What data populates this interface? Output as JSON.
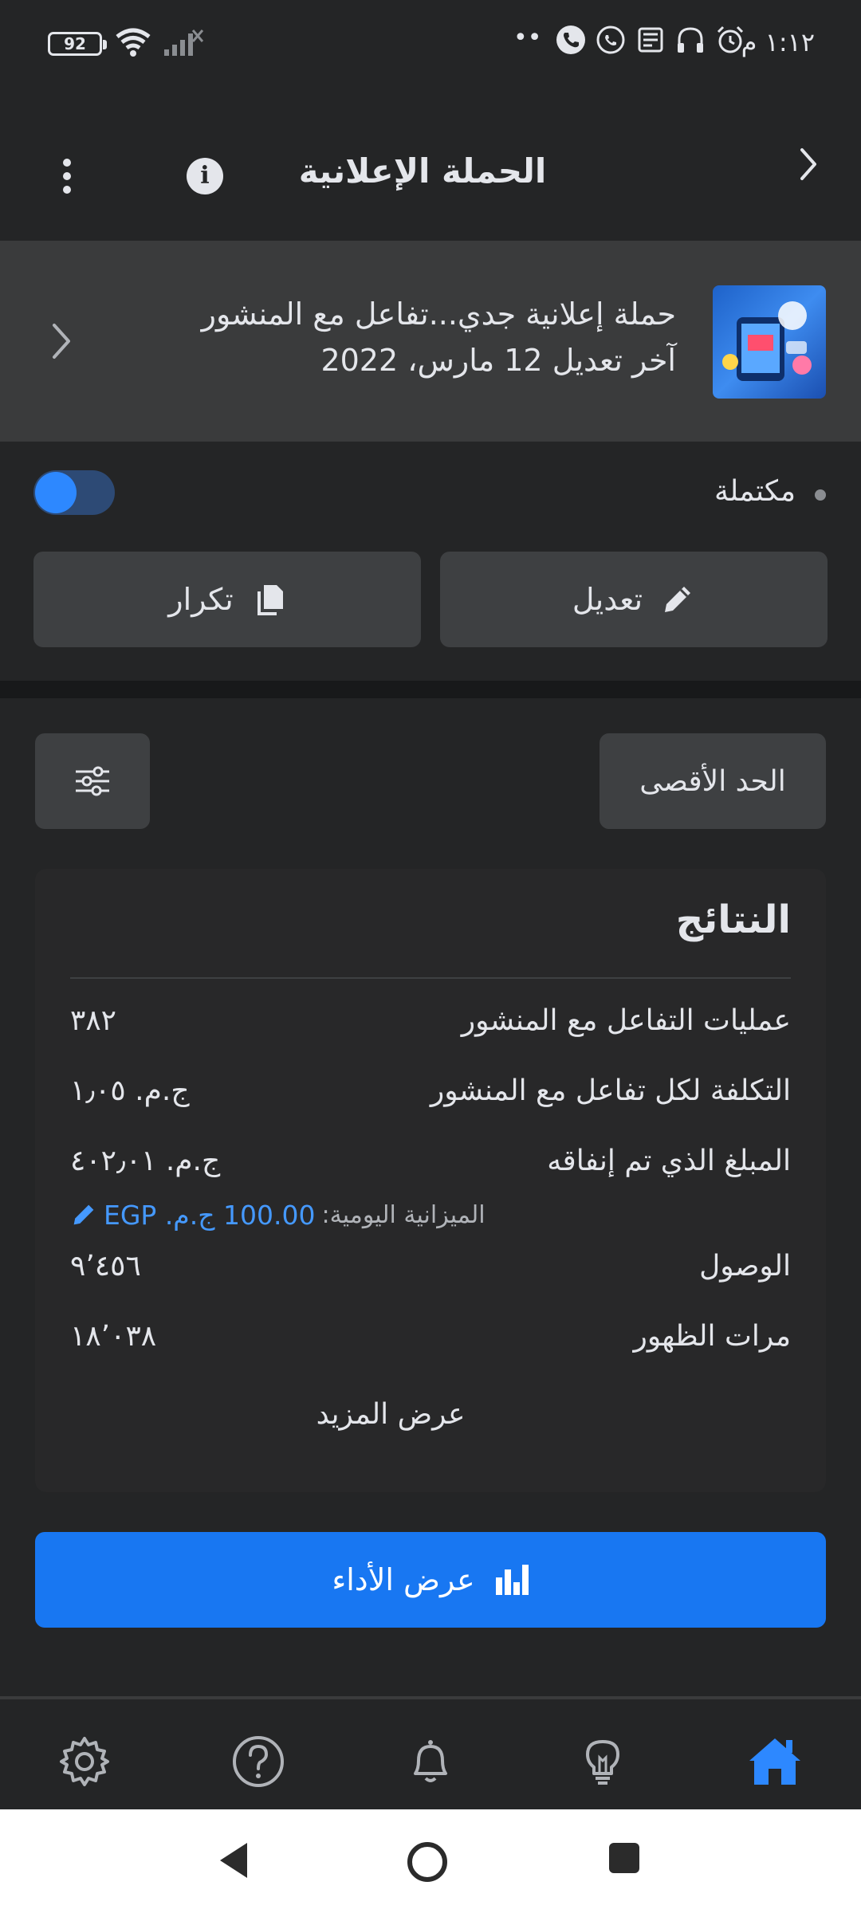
{
  "status_bar": {
    "time": "١:١٢ م",
    "battery": "92",
    "icons": [
      "wifi-icon",
      "signal-off-icon",
      "more-dots-icon",
      "phone-icon",
      "whatsapp-icon",
      "news-icon",
      "headset-icon",
      "alarm-icon"
    ]
  },
  "header": {
    "title": "الحملة الإعلانية",
    "back_icon": "chevron-left-icon",
    "info_icon": "info-icon",
    "more_icon": "more-vertical-icon"
  },
  "campaign": {
    "name": "حملة إعلانية جدي...تفاعل مع المنشور",
    "last_edited": "آخر تعديل 12 مارس، 2022"
  },
  "status": {
    "label": "مكتملة",
    "toggle_on": false
  },
  "actions": {
    "edit_label": "تعديل",
    "duplicate_label": "تكرار"
  },
  "filters": {
    "max_label": "الحد الأقصى",
    "filter_icon": "sliders-icon"
  },
  "results": {
    "title": "النتائج",
    "rows": [
      {
        "label": "عمليات  التفاعل مع المنشور",
        "value": "٣٨٢"
      },
      {
        "label": "التكلفة لكل تفاعل مع المنشور",
        "value": "ج.م. ١٫٠٥"
      },
      {
        "label": "المبلغ الذي تم إنفاقه",
        "value": "ج.م. ٤٠٢٫٠١"
      },
      {
        "label": "الوصول",
        "value": "٩٬٤٥٦"
      },
      {
        "label": "مرات الظهور",
        "value": "١٨٬٠٣٨"
      }
    ],
    "budget_label": "الميزانية اليومية:",
    "budget_value": "100.00 ج.م. EGP",
    "show_more": "عرض المزيد"
  },
  "performance_button": "عرض الأداء",
  "bottom_nav": [
    "settings-icon",
    "help-icon",
    "notifications-icon",
    "ideas-icon",
    "home-icon"
  ],
  "colors": {
    "accent": "#1877f2",
    "background": "#242526",
    "card": "#3a3b3c",
    "link": "#4599ff"
  }
}
